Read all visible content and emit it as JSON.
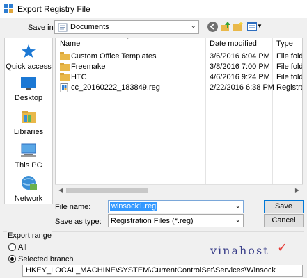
{
  "window": {
    "title": "Export Registry File"
  },
  "save_in": {
    "label": "Save in:",
    "value": "Documents"
  },
  "toolbar": {
    "icons": [
      "back-icon",
      "up-folder-icon",
      "new-folder-icon",
      "view-menu-icon"
    ]
  },
  "places": [
    {
      "label": "Quick access",
      "icon": "star-icon"
    },
    {
      "label": "Desktop",
      "icon": "desktop-icon"
    },
    {
      "label": "Libraries",
      "icon": "libraries-icon"
    },
    {
      "label": "This PC",
      "icon": "computer-icon"
    },
    {
      "label": "Network",
      "icon": "network-icon"
    }
  ],
  "file_list": {
    "columns": [
      "Name",
      "Date modified",
      "Type"
    ],
    "rows": [
      {
        "name": "Custom Office Templates",
        "date": "3/6/2016 6:04 PM",
        "type": "File folder",
        "icon": "folder-icon"
      },
      {
        "name": "Freemake",
        "date": "3/8/2016 7:00 PM",
        "type": "File folder",
        "icon": "folder-icon"
      },
      {
        "name": "HTC",
        "date": "4/6/2016 9:24 PM",
        "type": "File folder",
        "icon": "folder-icon"
      },
      {
        "name": "cc_20160222_183849.reg",
        "date": "2/22/2016 6:38 PM",
        "type": "Registration",
        "icon": "reg-file-icon"
      }
    ]
  },
  "filename": {
    "label": "File name:",
    "value": "winsock1.reg"
  },
  "save_as_type": {
    "label": "Save as type:",
    "value": "Registration Files (*.reg)"
  },
  "buttons": {
    "save": "Save",
    "cancel": "Cancel"
  },
  "export_range": {
    "title": "Export range",
    "all_label": "All",
    "selected_label": "Selected branch",
    "branch_value": "HKEY_LOCAL_MACHINE\\SYSTEM\\CurrentControlSet\\Services\\Winsock"
  },
  "watermark": {
    "text": "vinahost",
    "accent": "#e53935",
    "color": "#3a3f8a"
  }
}
